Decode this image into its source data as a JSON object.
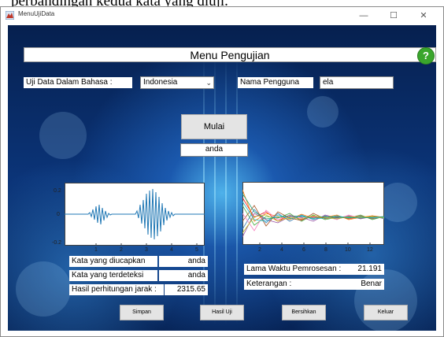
{
  "top_text": "perbandingan kedua kata yang diuji.",
  "window": {
    "title": "MenuUjiData",
    "minimize_glyph": "—",
    "maximize_glyph": "☐",
    "close_glyph": "✕"
  },
  "header": {
    "title": "Menu Pengujian",
    "help_glyph": "?"
  },
  "language": {
    "label": "Uji Data Dalam Bahasa :",
    "selected": "Indonesia"
  },
  "user": {
    "label": "Nama Pengguna",
    "value": "ela"
  },
  "mulai_label": "Mulai",
  "spoken_word": "anda",
  "waveform_plot": {
    "y_ticks": [
      "0.2",
      "0",
      "-0.2"
    ],
    "x_ticks": [
      "1",
      "2",
      "3",
      "4",
      "5"
    ]
  },
  "feature_plot": {
    "x_ticks": [
      "2",
      "4",
      "6",
      "8",
      "10",
      "12"
    ]
  },
  "results": {
    "kata_diucapkan_label": "Kata yang diucapkan",
    "kata_diucapkan_value": "anda",
    "kata_terdeteksi_label": "Kata yang terdeteksi",
    "kata_terdeteksi_value": "anda",
    "jarak_label": "Hasil perhitungan jarak :",
    "jarak_value": "2315.65",
    "waktu_label": "Lama Waktu Pemrosesan :",
    "waktu_value": "21.191",
    "keterangan_label": "Keterangan :",
    "keterangan_value": "Benar"
  },
  "buttons": {
    "simpan": "Simpan",
    "hasil_uji": "Hasil Uji",
    "bersihkan": "Bersihkan",
    "keluar": "Keluar"
  },
  "colors": {
    "waveform": "#1f77b4",
    "help": "#3aa62c",
    "background": "#0b3478"
  }
}
